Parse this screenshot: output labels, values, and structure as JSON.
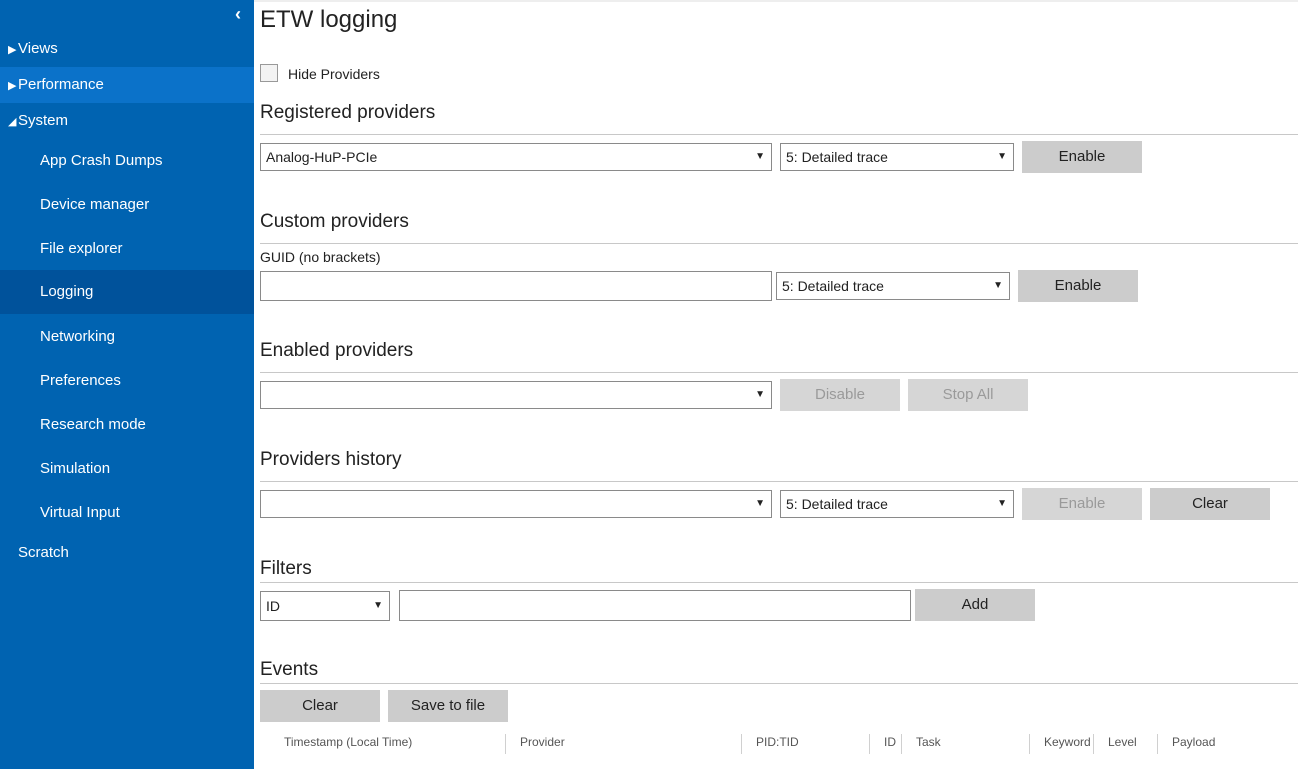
{
  "sidebar": {
    "collapse_icon": "chevron-left-icon",
    "top_items": [
      {
        "label": "Views",
        "arrow": "▶"
      },
      {
        "label": "Performance",
        "arrow": "▶"
      },
      {
        "label": "System",
        "arrow": "◢"
      }
    ],
    "system_items": [
      "App Crash Dumps",
      "Device manager",
      "File explorer",
      "Logging",
      "Networking",
      "Preferences",
      "Research mode",
      "Simulation",
      "Virtual Input"
    ],
    "scratch_label": "Scratch",
    "colors": {
      "bg": "#0063b1",
      "active": "#00529b",
      "hover": "#0b72c9"
    }
  },
  "page": {
    "title": "ETW logging",
    "hide_providers_label": "Hide Providers"
  },
  "registered": {
    "title": "Registered providers",
    "provider_value": "Analog-HuP-PCIe",
    "level_value": "5: Detailed trace",
    "enable_label": "Enable"
  },
  "custom": {
    "title": "Custom providers",
    "guid_label": "GUID (no brackets)",
    "guid_value": "",
    "level_value": "5: Detailed trace",
    "enable_label": "Enable"
  },
  "enabled": {
    "title": "Enabled providers",
    "provider_value": "",
    "disable_label": "Disable",
    "stop_all_label": "Stop All"
  },
  "history": {
    "title": "Providers history",
    "provider_value": "",
    "level_value": "5: Detailed trace",
    "enable_label": "Enable",
    "clear_label": "Clear"
  },
  "filters": {
    "title": "Filters",
    "field_value": "ID",
    "filter_value": "",
    "add_label": "Add"
  },
  "events": {
    "title": "Events",
    "clear_label": "Clear",
    "save_label": "Save to file",
    "columns": [
      "Timestamp (Local Time)",
      "Provider",
      "PID:TID",
      "ID",
      "Task",
      "Keyword",
      "Level",
      "Payload"
    ]
  }
}
